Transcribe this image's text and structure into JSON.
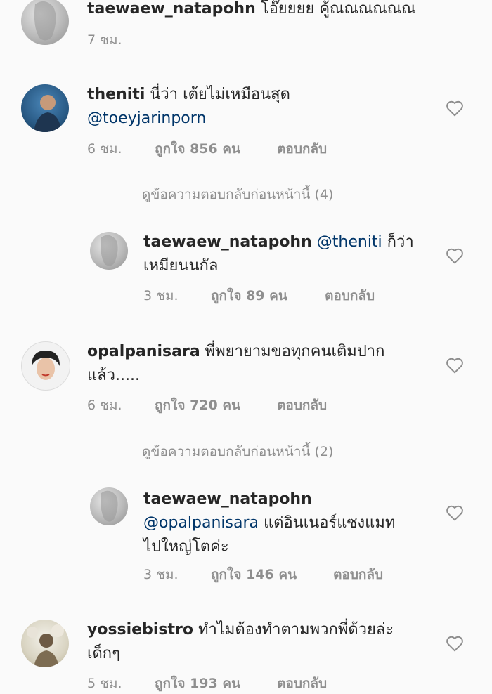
{
  "comments": [
    {
      "username": "taewaew_natapohn",
      "text": " โอ๊ยยยย คู้ณณณณณณ",
      "time": "7 ชม."
    },
    {
      "username": "theniti",
      "text": " นี่ว่า เต้ยไม่เหมือนสุด",
      "mention": "@toeyjarinporn",
      "time": "6 ชม.",
      "likes": "ถูกใจ 856 คน",
      "reply": "ตอบกลับ"
    },
    {
      "username": "opalpanisara",
      "text": " พี่พยายามขอทุกคนเติมปาก",
      "text2": "แล้ว.....",
      "time": "6 ชม.",
      "likes": "ถูกใจ 720 คน",
      "reply": "ตอบกลับ"
    },
    {
      "username": "yossiebistro",
      "text": " ทำไมต้องทำตามพวกพี่ด้วยล่ะ",
      "text2": "เด็กๆ",
      "time": "5 ชม.",
      "likes": "ถูกใจ 193 คน",
      "reply": "ตอบกลับ"
    }
  ],
  "replies": [
    {
      "view_previous": "ดูข้อความตอบกลับก่อนหน้านี้ (4)",
      "username": "taewaew_natapohn",
      "mention": "@theniti",
      "text": " ก็ว่า",
      "text2": "เหมียนนกัล",
      "time": "3 ชม.",
      "likes": "ถูกใจ 89 คน",
      "reply": "ตอบกลับ"
    },
    {
      "view_previous": "ดูข้อความตอบกลับก่อนหน้านี้ (2)",
      "username": "taewaew_natapohn",
      "mention": "@opalpanisara",
      "text": " แต่อินเนอร์แซงแมท",
      "text2": "ไปใหญ่โตค่ะ",
      "time": "3 ชม.",
      "likes": "ถูกใจ 146 คน",
      "reply": "ตอบกลับ"
    }
  ],
  "colors": {
    "text": "#262626",
    "meta": "#8e8e8e",
    "mention": "#003569",
    "background": "#fafafa"
  },
  "icons": {
    "like": "heart-outline-icon"
  }
}
